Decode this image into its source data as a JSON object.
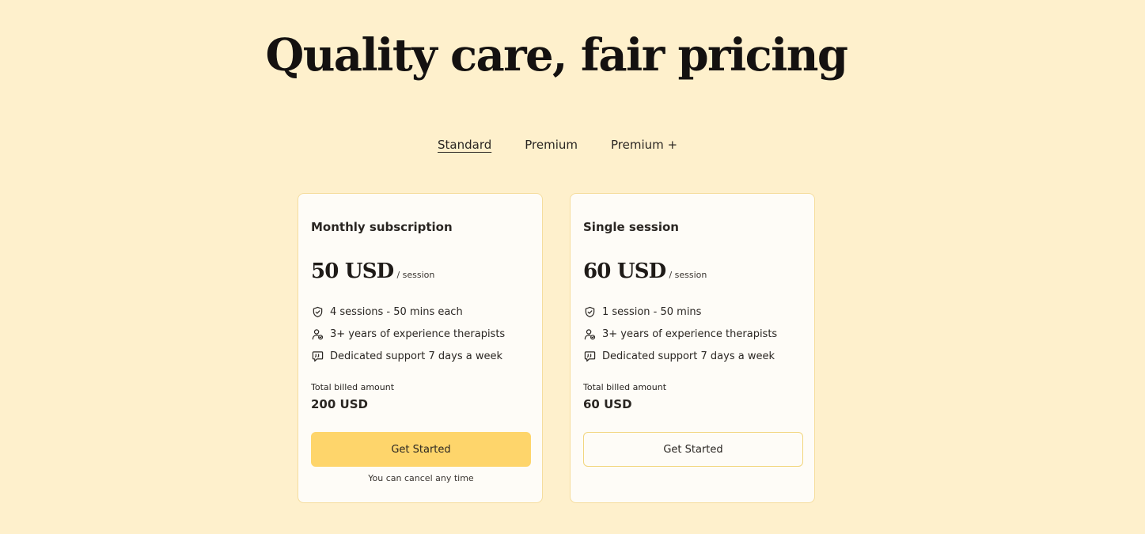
{
  "heading": "Quality care, fair pricing",
  "tabs": [
    {
      "label": "Standard",
      "active": true
    },
    {
      "label": "Premium",
      "active": false
    },
    {
      "label": "Premium +",
      "active": false
    }
  ],
  "plans": [
    {
      "title": "Monthly subscription",
      "price": "50 USD",
      "unit": "/ session",
      "features": [
        {
          "icon": "shield-check-icon",
          "text": "4 sessions - 50 mins each"
        },
        {
          "icon": "user-badge-icon",
          "text": "3+ years of experience therapists"
        },
        {
          "icon": "chat-quote-icon",
          "text": "Dedicated support 7 days a week"
        }
      ],
      "billed_label": "Total billed amount",
      "billed_amount": "200 USD",
      "button_label": "Get Started",
      "note": "You can cancel any time"
    },
    {
      "title": "Single session",
      "price": "60 USD",
      "unit": "/ session",
      "features": [
        {
          "icon": "shield-check-icon",
          "text": "1 session - 50 mins"
        },
        {
          "icon": "user-badge-icon",
          "text": "3+ years of experience therapists"
        },
        {
          "icon": "chat-quote-icon",
          "text": "Dedicated support 7 days a week"
        }
      ],
      "billed_label": "Total billed amount",
      "billed_amount": "60 USD",
      "button_label": "Get Started"
    }
  ],
  "colors": {
    "background": "#FEF0CC",
    "card": "#FEFCF7",
    "accent": "#FED56B",
    "text": "#2a2622"
  }
}
